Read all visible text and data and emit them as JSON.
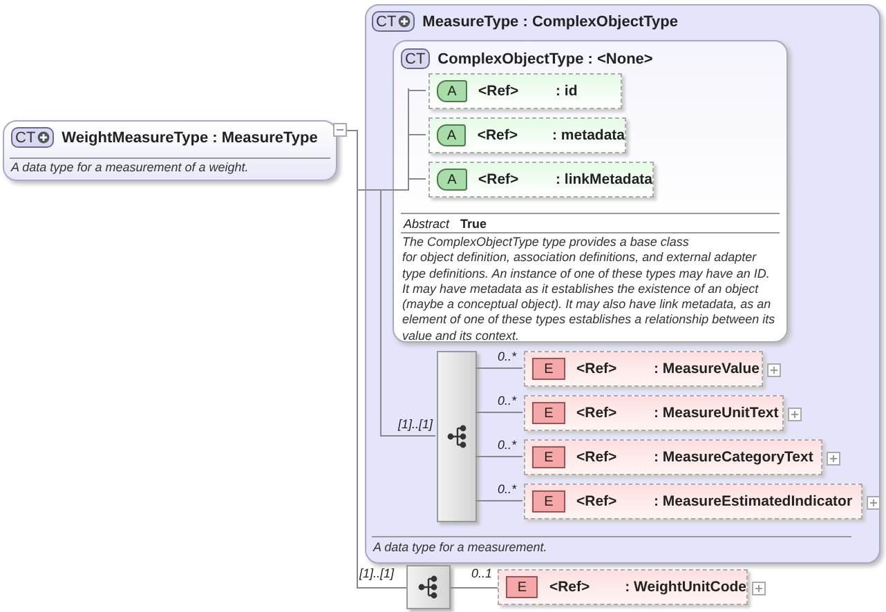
{
  "root": {
    "badge": "CT",
    "derived": true,
    "title": "WeightMeasureType : MeasureType",
    "description": "A data type for a measurement of a weight.",
    "expanded": true
  },
  "base_type": {
    "badge": "CT",
    "derived": true,
    "title": "MeasureType : ComplexObjectType",
    "description": "A data type for a measurement.",
    "inner": {
      "badge": "CT",
      "derived": false,
      "title": "ComplexObjectType : <None>",
      "attributes": [
        {
          "badge": "A",
          "ref": "<Ref>",
          "name": ": id"
        },
        {
          "badge": "A",
          "ref": "<Ref>",
          "name": ": metadata"
        },
        {
          "badge": "A",
          "ref": "<Ref>",
          "name": ": linkMetadata"
        }
      ],
      "properties": [
        {
          "key": "Abstract",
          "value": "True"
        }
      ],
      "description": "The ComplexObjectType type provides a base class\nfor object definition, association definitions, and external adapter\ntype definitions. An instance of one of these types may have an ID.\nIt may have metadata as it establishes the existence of an object\n(maybe a conceptual object). It may also have link metadata, as an\nelement of one of these types establishes a relationship between its\nvalue and its context."
    },
    "sequence": {
      "occurs": "[1]..[1]",
      "elements": [
        {
          "occurs": "0..*",
          "badge": "E",
          "ref": "<Ref>",
          "name": ": MeasureValue",
          "expanded": false
        },
        {
          "occurs": "0..*",
          "badge": "E",
          "ref": "<Ref>",
          "name": ": MeasureUnitText",
          "expanded": false
        },
        {
          "occurs": "0..*",
          "badge": "E",
          "ref": "<Ref>",
          "name": ": MeasureCategoryText",
          "expanded": false
        },
        {
          "occurs": "0..*",
          "badge": "E",
          "ref": "<Ref>",
          "name": ": MeasureEstimatedIndicator",
          "expanded": false
        }
      ]
    }
  },
  "sequence": {
    "occurs": "[1]..[1]",
    "elements": [
      {
        "occurs": "0..1",
        "badge": "E",
        "ref": "<Ref>",
        "name": ": WeightUnitCode",
        "expanded": false
      }
    ]
  }
}
